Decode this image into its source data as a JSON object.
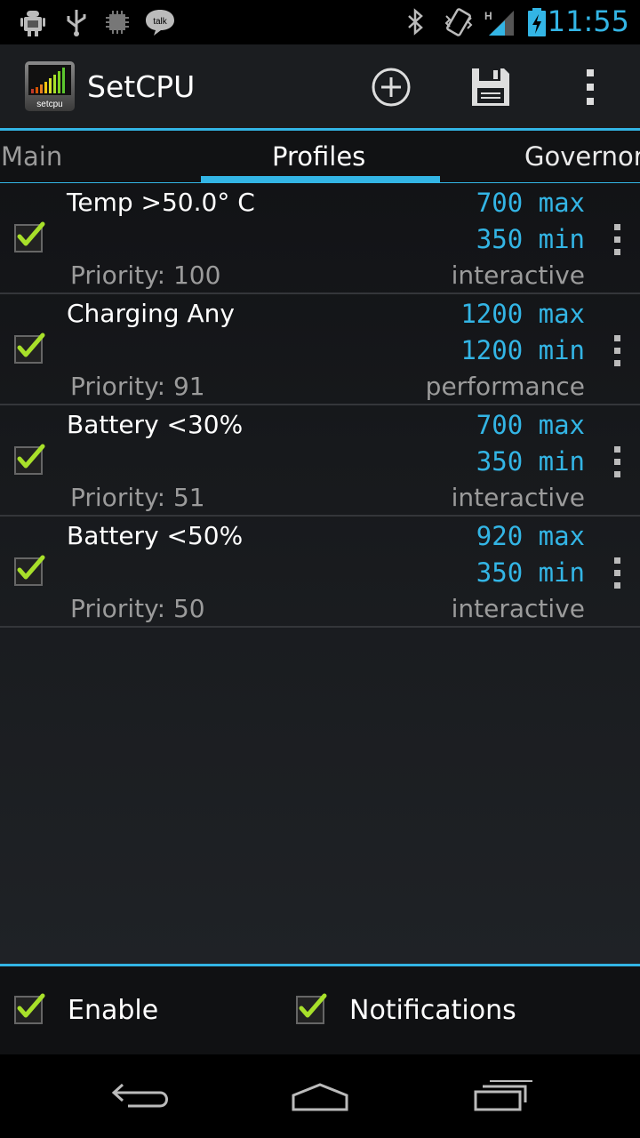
{
  "status_bar": {
    "time": "11:55",
    "left_icons": [
      "android-debug-icon",
      "usb-icon",
      "cpu-chip-icon",
      "talk-icon"
    ],
    "talk_label": "talk",
    "right_icons": [
      "bluetooth-icon",
      "vibrate-icon",
      "signal-icon",
      "battery-charging-icon"
    ],
    "network_type": "H"
  },
  "action_bar": {
    "app_title": "SetCPU",
    "app_icon_label": "setcpu",
    "actions": [
      "add-icon",
      "save-icon",
      "overflow-menu-icon"
    ]
  },
  "tabs": {
    "items": [
      {
        "label": "Main"
      },
      {
        "label": "Profiles"
      },
      {
        "label": "Governor"
      }
    ],
    "selected": "Profiles"
  },
  "profiles": [
    {
      "name": "Temp >50.0° C",
      "max": "700 max",
      "min": "350 min",
      "priority": "Priority: 100",
      "governor": "interactive",
      "checked": true
    },
    {
      "name": "Charging Any",
      "max": "1200 max",
      "min": "1200 min",
      "priority": "Priority: 91",
      "governor": "performance",
      "checked": true
    },
    {
      "name": "Battery <30%",
      "max": "700 max",
      "min": "350 min",
      "priority": "Priority: 51",
      "governor": "interactive",
      "checked": true
    },
    {
      "name": "Battery <50%",
      "max": "920 max",
      "min": "350 min",
      "priority": "Priority: 50",
      "governor": "interactive",
      "checked": true
    }
  ],
  "bottom_bar": {
    "enable_label": "Enable",
    "enable_checked": true,
    "notifications_label": "Notifications",
    "notifications_checked": true
  },
  "nav_bar": [
    "back-icon",
    "home-icon",
    "recent-apps-icon"
  ],
  "colors": {
    "accent": "#33b5e5",
    "check": "#a8e02a",
    "secondary_text": "#9b9b9b"
  }
}
